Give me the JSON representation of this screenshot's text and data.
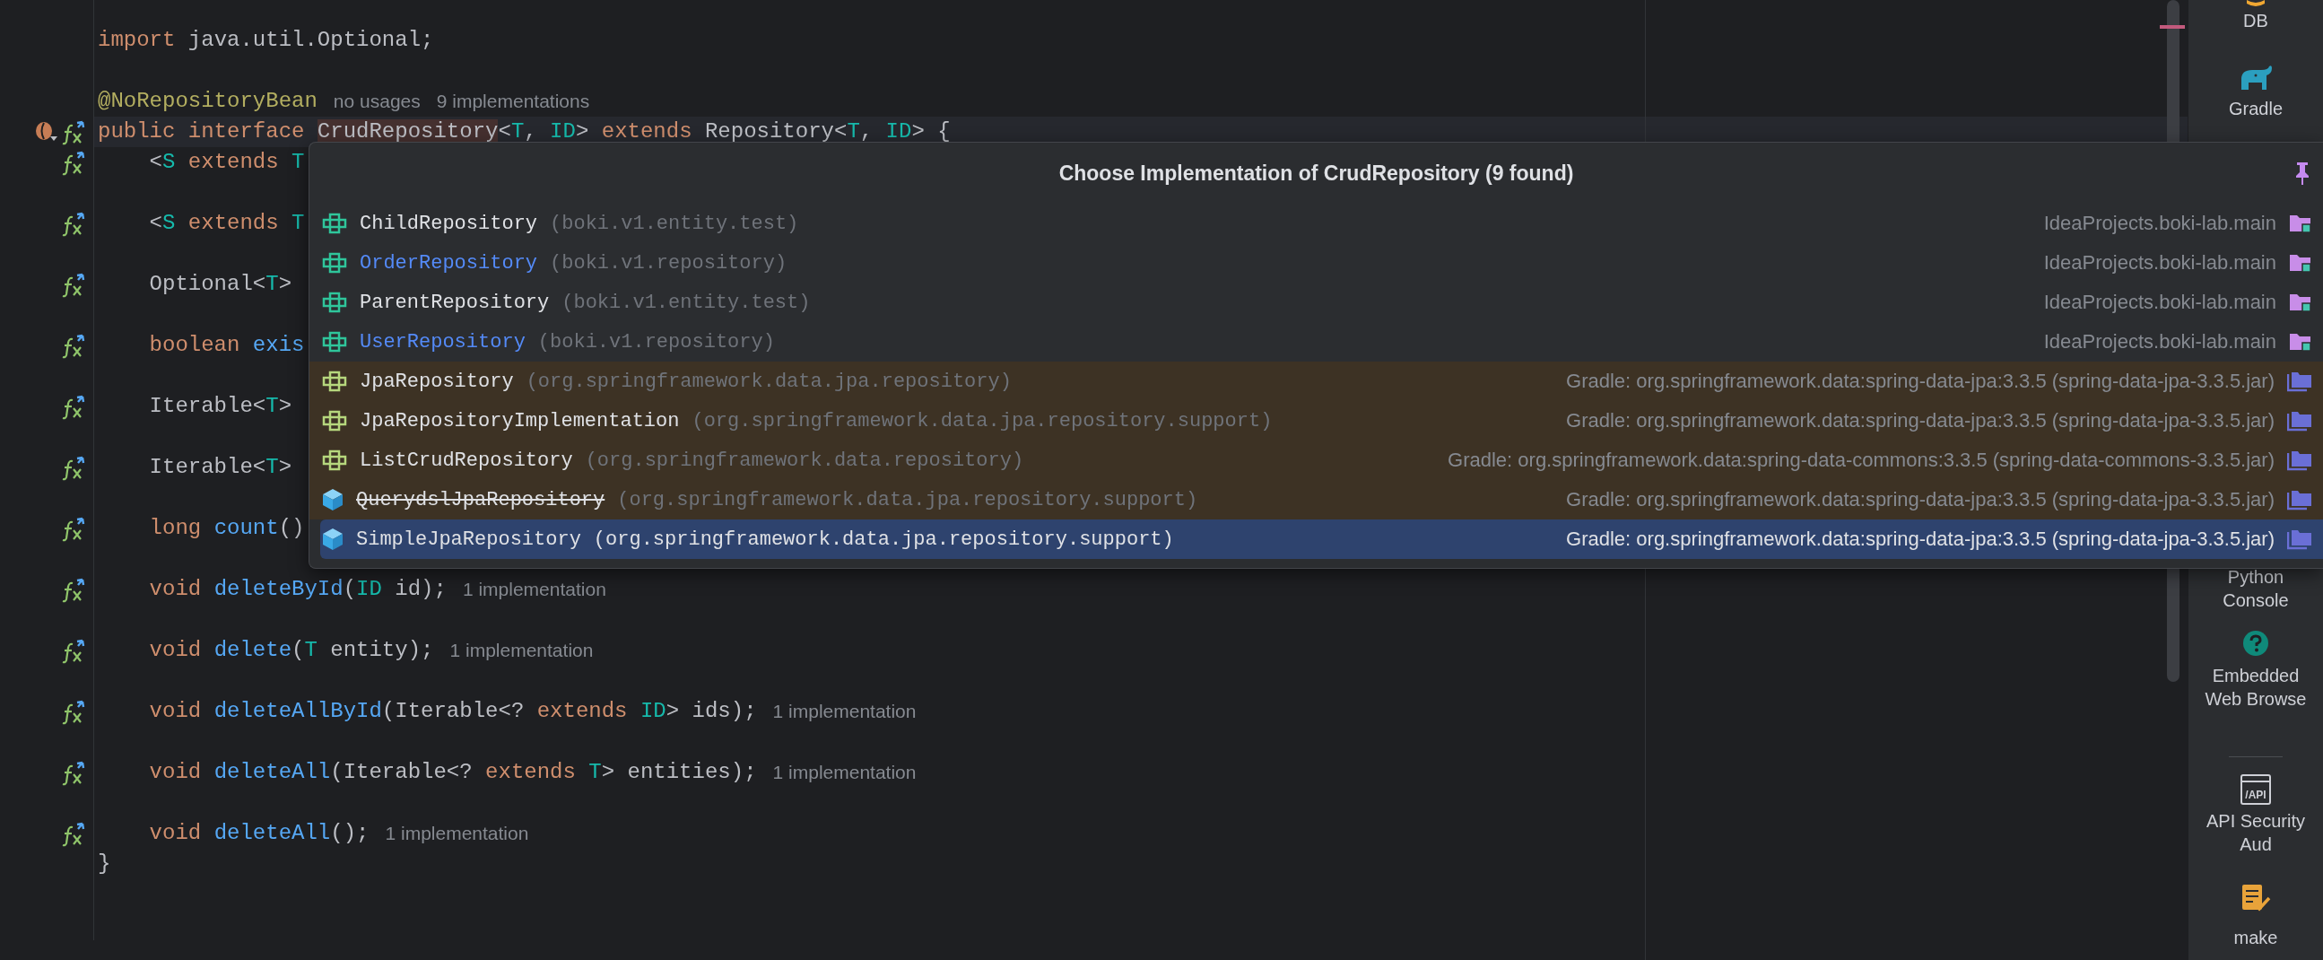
{
  "editor": {
    "lines": [
      {
        "current": false
      },
      {
        "current": false,
        "tokens": [
          {
            "t": "import ",
            "kind": "kw"
          },
          {
            "t": "java.util.Optional;",
            "kind": "plain"
          }
        ]
      },
      {
        "current": false
      },
      {
        "current": false,
        "tokens": [
          {
            "t": "@NoRepositoryBean",
            "kind": "ann"
          }
        ],
        "hints": [
          "no usages",
          "9 implementations"
        ]
      },
      {
        "current": true,
        "markers": [
          {
            "kind": "bean"
          },
          {
            "kind": "implemented"
          }
        ],
        "tokens": [
          {
            "t": "public interface ",
            "kind": "kw"
          },
          {
            "t": "CrudRepository",
            "kind": "ref"
          },
          {
            "t": "<",
            "kind": "plain"
          },
          {
            "t": "T",
            "kind": "tp"
          },
          {
            "t": ", ",
            "kind": "plain"
          },
          {
            "t": "ID",
            "kind": "tp"
          },
          {
            "t": "> ",
            "kind": "plain"
          },
          {
            "t": "extends ",
            "kind": "kw"
          },
          {
            "t": "Repository<",
            "kind": "plain"
          },
          {
            "t": "T",
            "kind": "tp"
          },
          {
            "t": ", ",
            "kind": "plain"
          },
          {
            "t": "ID",
            "kind": "tp"
          },
          {
            "t": "> {",
            "kind": "plain"
          }
        ]
      },
      {
        "current": false,
        "markers": [
          {
            "kind": "implemented"
          }
        ],
        "tokens": [
          {
            "t": "    <",
            "kind": "plain"
          },
          {
            "t": "S ",
            "kind": "tp"
          },
          {
            "t": "extends ",
            "kind": "kw"
          },
          {
            "t": "T",
            "kind": "tp"
          }
        ]
      },
      {
        "current": false
      },
      {
        "current": false,
        "markers": [
          {
            "kind": "implemented"
          }
        ],
        "tokens": [
          {
            "t": "    <",
            "kind": "plain"
          },
          {
            "t": "S ",
            "kind": "tp"
          },
          {
            "t": "extends ",
            "kind": "kw"
          },
          {
            "t": "T",
            "kind": "tp"
          }
        ]
      },
      {
        "current": false
      },
      {
        "current": false,
        "markers": [
          {
            "kind": "implemented"
          }
        ],
        "tokens": [
          {
            "t": "    Optional<",
            "kind": "plain"
          },
          {
            "t": "T",
            "kind": "tp"
          },
          {
            "t": ">",
            "kind": "plain"
          }
        ]
      },
      {
        "current": false
      },
      {
        "current": false,
        "markers": [
          {
            "kind": "implemented"
          }
        ],
        "tokens": [
          {
            "t": "    boolean ",
            "kind": "kw"
          },
          {
            "t": "exis",
            "kind": "method"
          }
        ]
      },
      {
        "current": false
      },
      {
        "current": false,
        "markers": [
          {
            "kind": "implemented"
          }
        ],
        "tokens": [
          {
            "t": "    Iterable<",
            "kind": "plain"
          },
          {
            "t": "T",
            "kind": "tp"
          },
          {
            "t": ">",
            "kind": "plain"
          }
        ]
      },
      {
        "current": false
      },
      {
        "current": false,
        "markers": [
          {
            "kind": "implemented"
          }
        ],
        "tokens": [
          {
            "t": "    Iterable<",
            "kind": "plain"
          },
          {
            "t": "T",
            "kind": "tp"
          },
          {
            "t": ">",
            "kind": "plain"
          }
        ]
      },
      {
        "current": false
      },
      {
        "current": false,
        "markers": [
          {
            "kind": "implemented"
          }
        ],
        "tokens": [
          {
            "t": "    long ",
            "kind": "kw"
          },
          {
            "t": "count",
            "kind": "method"
          },
          {
            "t": "()",
            "kind": "plain"
          }
        ]
      },
      {
        "current": false
      },
      {
        "current": false,
        "markers": [
          {
            "kind": "implemented"
          }
        ],
        "tokens": [
          {
            "t": "    void ",
            "kind": "kw"
          },
          {
            "t": "deleteById",
            "kind": "method"
          },
          {
            "t": "(",
            "kind": "plain"
          },
          {
            "t": "ID",
            "kind": "tp"
          },
          {
            "t": " id);",
            "kind": "plain"
          }
        ],
        "hints": [
          "1 implementation"
        ]
      },
      {
        "current": false
      },
      {
        "current": false,
        "markers": [
          {
            "kind": "implemented"
          }
        ],
        "tokens": [
          {
            "t": "    void ",
            "kind": "kw"
          },
          {
            "t": "delete",
            "kind": "method"
          },
          {
            "t": "(",
            "kind": "plain"
          },
          {
            "t": "T",
            "kind": "tp"
          },
          {
            "t": " entity);",
            "kind": "plain"
          }
        ],
        "hints": [
          "1 implementation"
        ]
      },
      {
        "current": false
      },
      {
        "current": false,
        "markers": [
          {
            "kind": "implemented"
          }
        ],
        "tokens": [
          {
            "t": "    void ",
            "kind": "kw"
          },
          {
            "t": "deleteAllById",
            "kind": "method"
          },
          {
            "t": "(Iterable<? ",
            "kind": "plain"
          },
          {
            "t": "extends ",
            "kind": "kw"
          },
          {
            "t": "ID",
            "kind": "tp"
          },
          {
            "t": "> ids);",
            "kind": "plain"
          }
        ],
        "hints": [
          "1 implementation"
        ]
      },
      {
        "current": false
      },
      {
        "current": false,
        "markers": [
          {
            "kind": "implemented"
          }
        ],
        "tokens": [
          {
            "t": "    void ",
            "kind": "kw"
          },
          {
            "t": "deleteAll",
            "kind": "method"
          },
          {
            "t": "(Iterable<? ",
            "kind": "plain"
          },
          {
            "t": "extends ",
            "kind": "kw"
          },
          {
            "t": "T",
            "kind": "tp"
          },
          {
            "t": "> entities);",
            "kind": "plain"
          }
        ],
        "hints": [
          "1 implementation"
        ]
      },
      {
        "current": false
      },
      {
        "current": false,
        "markers": [
          {
            "kind": "implemented"
          }
        ],
        "tokens": [
          {
            "t": "    void ",
            "kind": "kw"
          },
          {
            "t": "deleteAll",
            "kind": "method"
          },
          {
            "t": "();",
            "kind": "plain"
          }
        ],
        "hints": [
          "1 implementation"
        ]
      },
      {
        "current": false,
        "tokens": [
          {
            "t": "}",
            "kind": "plain"
          }
        ]
      },
      {
        "current": false
      },
      {
        "current": false
      }
    ]
  },
  "popup": {
    "title": "Choose Implementation of CrudRepository (9 found)",
    "items": [
      {
        "name": "ChildRepository",
        "package": "(boki.v1.entity.test)",
        "location": "IdeaProjects.boki-lab.main",
        "kind": "interface",
        "library": false,
        "modified": false,
        "deprecated": false,
        "selected": false
      },
      {
        "name": "OrderRepository",
        "package": "(boki.v1.repository)",
        "location": "IdeaProjects.boki-lab.main",
        "kind": "interface",
        "library": false,
        "modified": true,
        "deprecated": false,
        "selected": false
      },
      {
        "name": "ParentRepository",
        "package": "(boki.v1.entity.test)",
        "location": "IdeaProjects.boki-lab.main",
        "kind": "interface",
        "library": false,
        "modified": false,
        "deprecated": false,
        "selected": false
      },
      {
        "name": "UserRepository",
        "package": "(boki.v1.repository)",
        "location": "IdeaProjects.boki-lab.main",
        "kind": "interface",
        "library": false,
        "modified": true,
        "deprecated": false,
        "selected": false
      },
      {
        "name": "JpaRepository",
        "package": "(org.springframework.data.jpa.repository)",
        "location": "Gradle: org.springframework.data:spring-data-jpa:3.3.5 (spring-data-jpa-3.3.5.jar)",
        "kind": "library-interface",
        "library": true,
        "modified": false,
        "deprecated": false,
        "selected": false
      },
      {
        "name": "JpaRepositoryImplementation",
        "package": "(org.springframework.data.jpa.repository.support)",
        "location": "Gradle: org.springframework.data:spring-data-jpa:3.3.5 (spring-data-jpa-3.3.5.jar)",
        "kind": "library-interface",
        "library": true,
        "modified": false,
        "deprecated": false,
        "selected": false
      },
      {
        "name": "ListCrudRepository",
        "package": "(org.springframework.data.repository)",
        "location": "Gradle: org.springframework.data:spring-data-commons:3.3.5 (spring-data-commons-3.3.5.jar)",
        "kind": "library-interface",
        "library": true,
        "modified": false,
        "deprecated": false,
        "selected": false
      },
      {
        "name": "QuerydslJpaRepository",
        "package": "(org.springframework.data.jpa.repository.support)",
        "location": "Gradle: org.springframework.data:spring-data-jpa:3.3.5 (spring-data-jpa-3.3.5.jar)",
        "kind": "class",
        "library": true,
        "modified": false,
        "deprecated": true,
        "selected": false
      },
      {
        "name": "SimpleJpaRepository",
        "package": "(org.springframework.data.jpa.repository.support)",
        "location": "Gradle: org.springframework.data:spring-data-jpa:3.3.5 (spring-data-jpa-3.3.5.jar)",
        "kind": "class",
        "library": true,
        "modified": false,
        "deprecated": false,
        "selected": true
      }
    ]
  },
  "sidebar": {
    "items": [
      {
        "label": "DB",
        "kind": "database"
      },
      {
        "label": "Gradle",
        "kind": "gradle"
      },
      {
        "label": "Python Console",
        "kind": "hidden"
      },
      {
        "label": "Embedded Web Browse",
        "kind": "help"
      },
      {
        "label": "API Security Aud",
        "kind": "api",
        "icon_text": "/API"
      },
      {
        "label": "make",
        "kind": "make"
      }
    ]
  }
}
